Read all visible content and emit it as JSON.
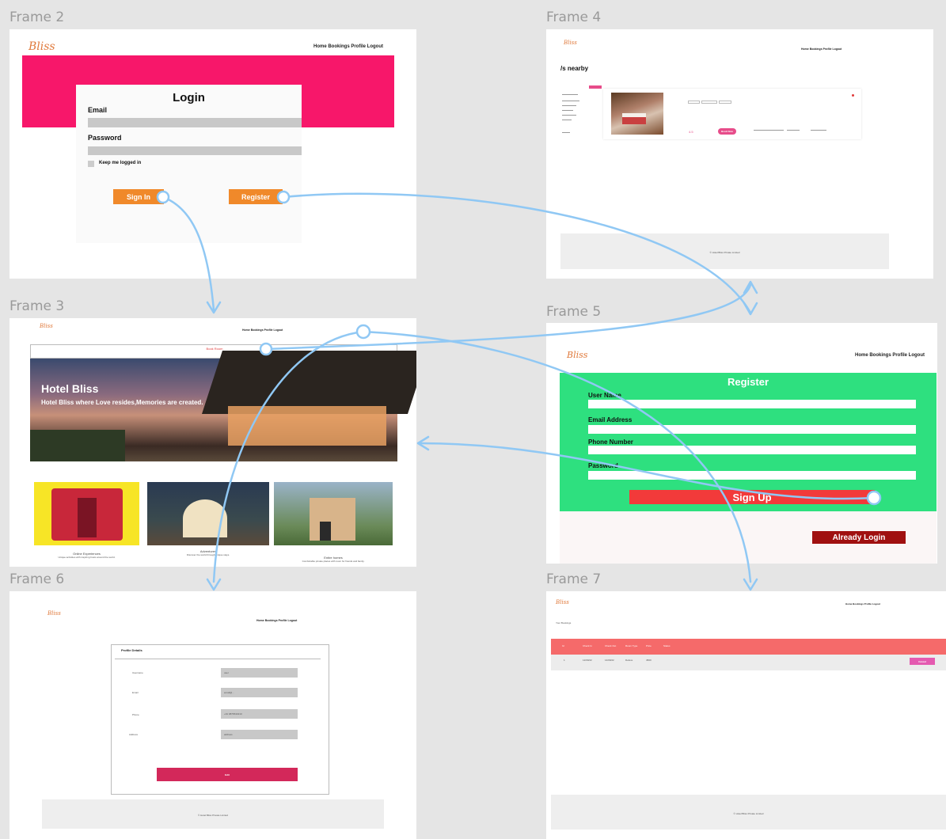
{
  "frame_labels": {
    "f2": "Frame 2",
    "f3": "Frame 3",
    "f4": "Frame 4",
    "f5": "Frame 5",
    "f6": "Frame 6",
    "f7": "Frame 7"
  },
  "brand": "Bliss",
  "brand_short": "Bliss",
  "nav": "Home Bookings Profile Logout",
  "frame2": {
    "title": "Login",
    "email_label": "Email",
    "password_label": "Password",
    "keep_logged": "Keep me logged in",
    "signin": "Sign In",
    "register": "Register",
    "colors": {
      "banner": "#f7176a",
      "button": "#f0892a"
    }
  },
  "frame3": {
    "book_now": "Book Room",
    "hero_title": "Hotel Bliss",
    "hero_subtitle": "Hotel Bliss where Love resides,Memories are created.",
    "cards": [
      {
        "title": "Online Experiences",
        "desc": "Unique activities with inspiring hosts around the world."
      },
      {
        "title": "Adventures",
        "desc": "Discover the world through unique stays."
      },
      {
        "title": "Entire homes",
        "desc": "Comfortable private places with room for friends and family."
      }
    ]
  },
  "frame4": {
    "heading": "/s nearby",
    "filter_btn": "Search",
    "rating": "4.5",
    "book": "Book Now",
    "footer": "© Hotel Bliss Private Limited"
  },
  "frame5": {
    "title": "Register",
    "fields": [
      "User Name",
      "Email Address",
      "Phone Number",
      "Password"
    ],
    "signup": "Sign Up",
    "already": "Already Login",
    "colors": {
      "panel": "#2ee07f",
      "signup": "#f23a3a",
      "already": "#a01010"
    }
  },
  "frame6": {
    "card_title": "Profile Details",
    "rows": [
      "Username",
      "Email",
      "Phone",
      "Address"
    ],
    "values": [
      "user",
      "email@...",
      "+91 9876543210",
      "address"
    ],
    "save": "Edit",
    "footer": "© Hotel Bliss Private Limited"
  },
  "frame7": {
    "heading": "Your Bookings",
    "columns": [
      "Id",
      "Check In",
      "Check Out",
      "Room Type",
      "Price",
      "Status"
    ],
    "row": [
      "1",
      "12/09/22",
      "14/09/22",
      "Deluxe",
      "4500"
    ],
    "cancel": "Cancel",
    "footer": "© Hotel Bliss Private Limited"
  }
}
